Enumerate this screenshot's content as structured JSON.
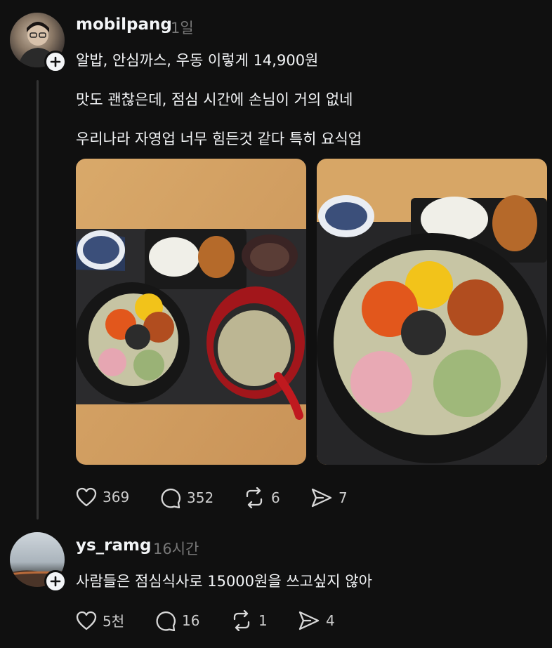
{
  "post": {
    "username": "mobilpang",
    "time": "1일",
    "lines": [
      "알밥, 안심까스, 우동 이렇게 14,900원",
      "맛도 괜찮은데, 점심 시간에 손님이 거의 없네",
      "우리나라 자영업 너무 힘든것 같다 특히 요식업"
    ],
    "likes": "369",
    "comments": "352",
    "reposts": "6",
    "shares": "7"
  },
  "reply": {
    "username": "ys_ramg",
    "time": "16시간",
    "text": "사람들은 점심식사로 15000원을 쓰고싶지 않아",
    "likes": "5천",
    "comments": "16",
    "reposts": "1",
    "shares": "4"
  },
  "icons": [
    "plus-icon",
    "heart-icon",
    "comment-icon",
    "repost-icon",
    "share-icon"
  ],
  "colors": {
    "background": "#101010",
    "text": "#f3f5f7",
    "muted": "#777777",
    "line": "#333333"
  }
}
